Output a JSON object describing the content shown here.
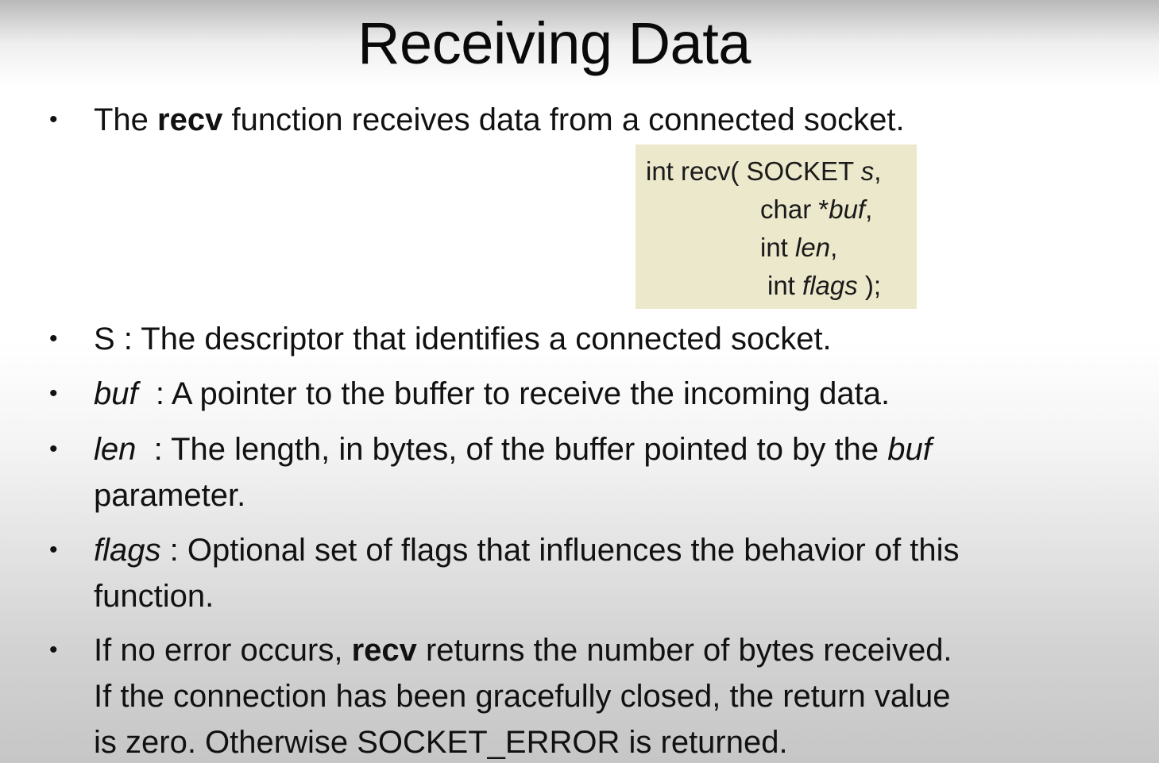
{
  "title": "Receiving Data",
  "bullet_symbol": "•",
  "bullets": [
    {
      "pre": "The ",
      "bold": "recv",
      "post": " function receives data from a connected socket."
    },
    {
      "line": "S : The descriptor that identifies a connected socket."
    },
    {
      "term": "buf",
      "desc": "  : A pointer to the buffer to receive the incoming data."
    },
    {
      "term": "len",
      "desc": "  : The length, in bytes, of the buffer pointed to by the ",
      "term2": "buf",
      "line2": "parameter."
    },
    {
      "term": "flags",
      "desc": " : Optional set of flags that influences the behavior of this",
      "line2": "function."
    },
    {
      "pre": "If no error occurs, ",
      "bold": "recv",
      "post": " returns the number of bytes received.",
      "line2": "If the connection has been gracefully closed, the return value",
      "line3": "is zero. Otherwise SOCKET_ERROR is returned."
    }
  ],
  "code": {
    "line1_pre": "int recv( SOCKET ",
    "line1_param": "s",
    "line1_post": ",",
    "line2_pre": "char *",
    "line2_param": "buf",
    "line2_post": ",",
    "line3_pre": "int ",
    "line3_param": "len",
    "line3_post": ",",
    "line4_pre": "int ",
    "line4_param": "flags",
    "line4_post": " );"
  },
  "colors": {
    "code_background": "#ece8cc",
    "text": "#111111"
  }
}
